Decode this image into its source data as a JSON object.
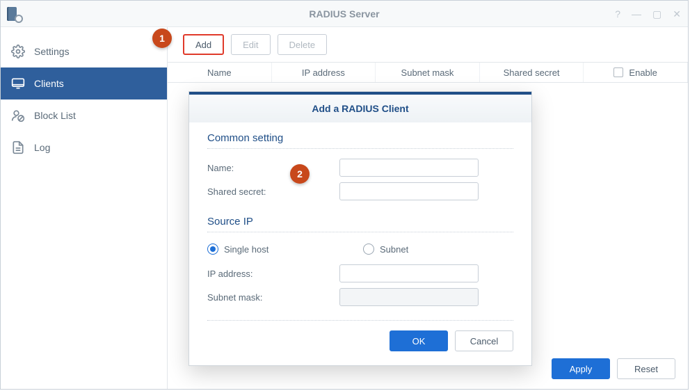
{
  "window": {
    "title": "RADIUS Server"
  },
  "sidebar": {
    "items": [
      {
        "label": "Settings"
      },
      {
        "label": "Clients"
      },
      {
        "label": "Block List"
      },
      {
        "label": "Log"
      }
    ]
  },
  "toolbar": {
    "add": "Add",
    "edit": "Edit",
    "delete": "Delete"
  },
  "table": {
    "headers": {
      "name": "Name",
      "ip": "IP address",
      "subnet": "Subnet mask",
      "secret": "Shared secret",
      "enable": "Enable"
    }
  },
  "dialog": {
    "title": "Add a RADIUS Client",
    "section_common": "Common setting",
    "name_label": "Name:",
    "name_value": "",
    "secret_label": "Shared secret:",
    "secret_value": "",
    "section_sourceip": "Source IP",
    "radio_single": "Single host",
    "radio_subnet": "Subnet",
    "ip_label": "IP address:",
    "ip_value": "",
    "mask_label": "Subnet mask:",
    "mask_value": "",
    "ok": "OK",
    "cancel": "Cancel"
  },
  "footer": {
    "apply": "Apply",
    "reset": "Reset"
  },
  "callouts": {
    "n1": "1",
    "n2": "2"
  }
}
